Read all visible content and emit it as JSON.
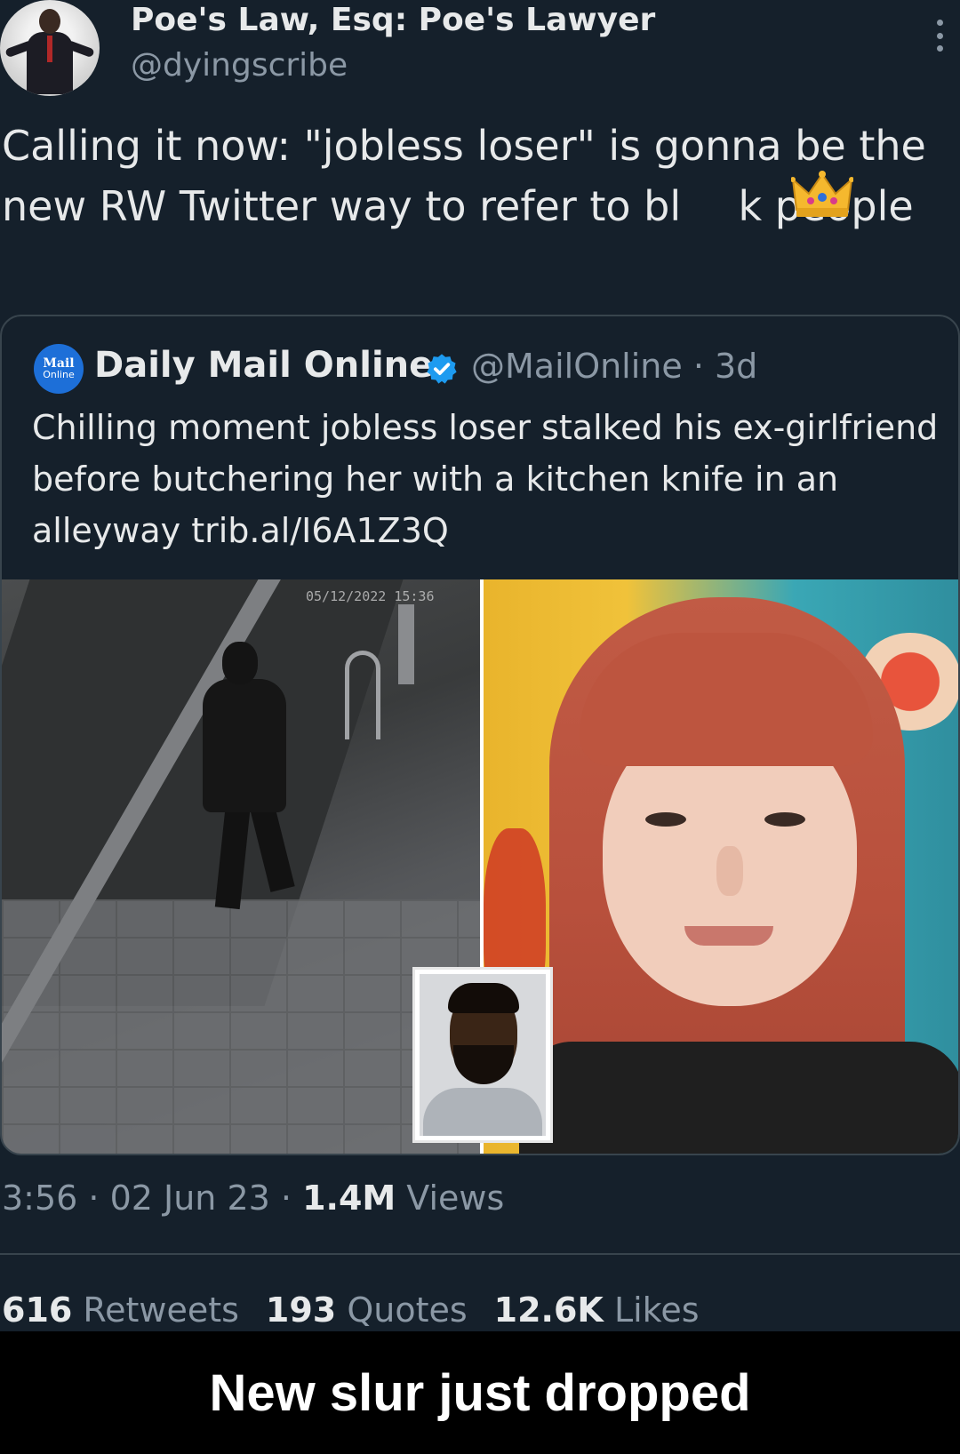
{
  "tweet": {
    "author_name": "Poe's Law, Esq: Poe's Lawyer",
    "author_handle": "@dyingscribe",
    "text": "Calling it now: \"jobless loser\" is gonna be the new RW Twitter way to refer to bl       k people",
    "time": "3:56 · 02 Jun 23 · ",
    "views_count": "1.4M",
    "views_label": " Views"
  },
  "quoted_tweet": {
    "logo_line1": "Mail",
    "logo_line2": "Online",
    "name": "Daily Mail Online",
    "handle_time": "@MailOnline · 3d",
    "text": "Chilling moment jobless loser stalked his ex-girlfriend before butchering her with a kitchen knife in an alleyway trib.al/I6A1Z3Q",
    "cctv_timestamp": "05/12/2022 15:36"
  },
  "stats": {
    "retweets_count": "616",
    "retweets_label": " Retweets",
    "quotes_count": "193",
    "quotes_label": " Quotes",
    "likes_count": "12.6K",
    "likes_label": " Likes"
  },
  "caption": "New slur just dropped",
  "colors": {
    "background": "#15202b",
    "text_primary": "#e7e9ea",
    "text_secondary": "#8b98a5",
    "verified": "#1d9bf0",
    "caption_bg": "#000000"
  },
  "icons": [
    "more-vertical-icon",
    "verified-badge-icon",
    "crown-icon"
  ]
}
